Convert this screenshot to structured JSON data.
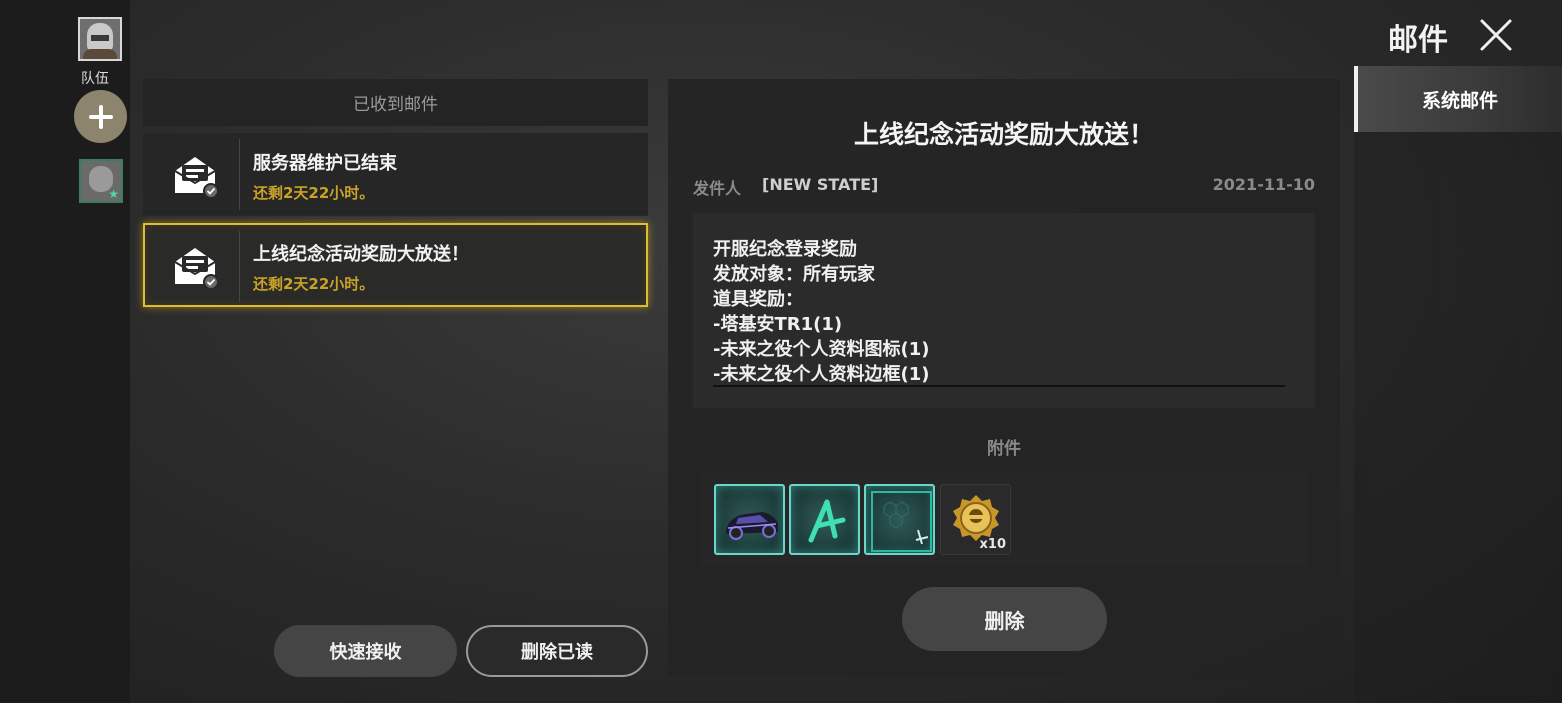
{
  "sidebar": {
    "team_label": "队伍",
    "icons": {
      "avatar": "player-avatar",
      "add": "plus-icon",
      "member": "team-member-avatar"
    }
  },
  "header": {
    "title": "邮件",
    "close_icon": "close-icon"
  },
  "tabs": [
    {
      "label": "系统邮件",
      "active": true
    }
  ],
  "mail_list": {
    "header": "已收到邮件",
    "items": [
      {
        "title": "服务器维护已结束",
        "remaining": "还剩2天22小时。",
        "selected": false,
        "icon": "mail-opened-icon"
      },
      {
        "title": "上线纪念活动奖励大放送！",
        "remaining": "还剩2天22小时。",
        "selected": true,
        "icon": "mail-opened-icon"
      }
    ],
    "quick_receive_label": "快速接收",
    "delete_read_label": "删除已读"
  },
  "detail": {
    "title": "上线纪念活动奖励大放送！",
    "sender_label": "发件人",
    "sender_name": "[NEW STATE]",
    "date": "2021-11-10",
    "content_lines": [
      "开服纪念登录奖励",
      "发放对象：所有玩家",
      "道具奖励：",
      "-塔基安TR1(1)",
      "-未来之役个人资料图标(1)",
      "-未来之役个人资料边框(1)"
    ],
    "attachments_label": "附件",
    "attachments": [
      {
        "icon": "car-icon",
        "quantity": ""
      },
      {
        "icon": "profile-icon-a",
        "quantity": ""
      },
      {
        "icon": "profile-frame-icon",
        "quantity": ""
      },
      {
        "icon": "gold-medal-icon",
        "quantity": "x10"
      }
    ],
    "delete_label": "删除"
  },
  "colors": {
    "accent_gold": "#e2bd2a",
    "remaining_text": "#c9a227",
    "teal_border": "#6ad6cc"
  }
}
